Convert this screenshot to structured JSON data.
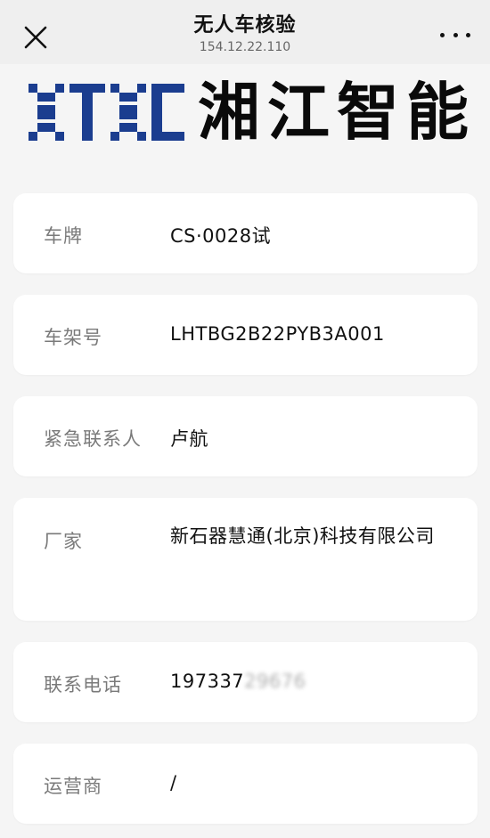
{
  "header": {
    "title": "无人车核验",
    "subtitle": "154.12.22.110"
  },
  "logo": {
    "brand_text": "湘江智能",
    "mark_text": "XTXC",
    "mark_color": "#1b3d8f"
  },
  "fields": {
    "plate": {
      "label": "车牌",
      "value": "CS·0028试"
    },
    "vin": {
      "label": "车架号",
      "value": "LHTBG2B22PYB3A001"
    },
    "contact": {
      "label": "紧急联系人",
      "value": "卢航"
    },
    "maker": {
      "label": "厂家",
      "value": "新石器慧通(北京)科技有限公司"
    },
    "phone": {
      "label": "联系电话",
      "value_visible": "197337",
      "value_obscured": "29676"
    },
    "operator": {
      "label": "运营商",
      "value": "/"
    }
  }
}
